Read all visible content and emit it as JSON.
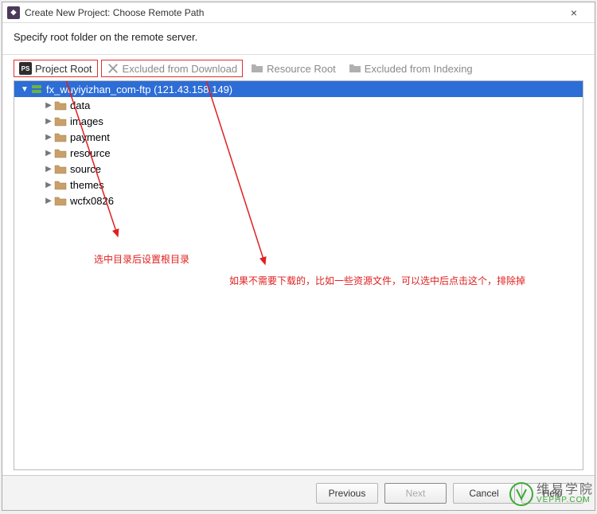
{
  "window": {
    "title": "Create New Project: Choose Remote Path",
    "close": "×"
  },
  "instruction": "Specify root folder on the remote server.",
  "toolbar": {
    "project_root": "Project Root",
    "excluded": "Excluded from Download",
    "resource_root": "Resource Root",
    "excluded_index": "Excluded from Indexing"
  },
  "tree": {
    "root_label": "fx_wuyiyizhan_com-ftp (121.43.158.149)",
    "children": [
      {
        "label": "data"
      },
      {
        "label": "images"
      },
      {
        "label": "payment"
      },
      {
        "label": "resource"
      },
      {
        "label": "source"
      },
      {
        "label": "themes"
      },
      {
        "label": "wcfx0826"
      }
    ]
  },
  "annotations": {
    "left": "选中目录后设置根目录",
    "right": "如果不需要下载的，比如一些资源文件，可以选中后点击这个，排除掉"
  },
  "buttons": {
    "previous": "Previous",
    "next": "Next",
    "cancel": "Cancel",
    "help": "Help"
  },
  "watermark": {
    "cn": "维易学院",
    "en": "VEPHP.COM"
  }
}
